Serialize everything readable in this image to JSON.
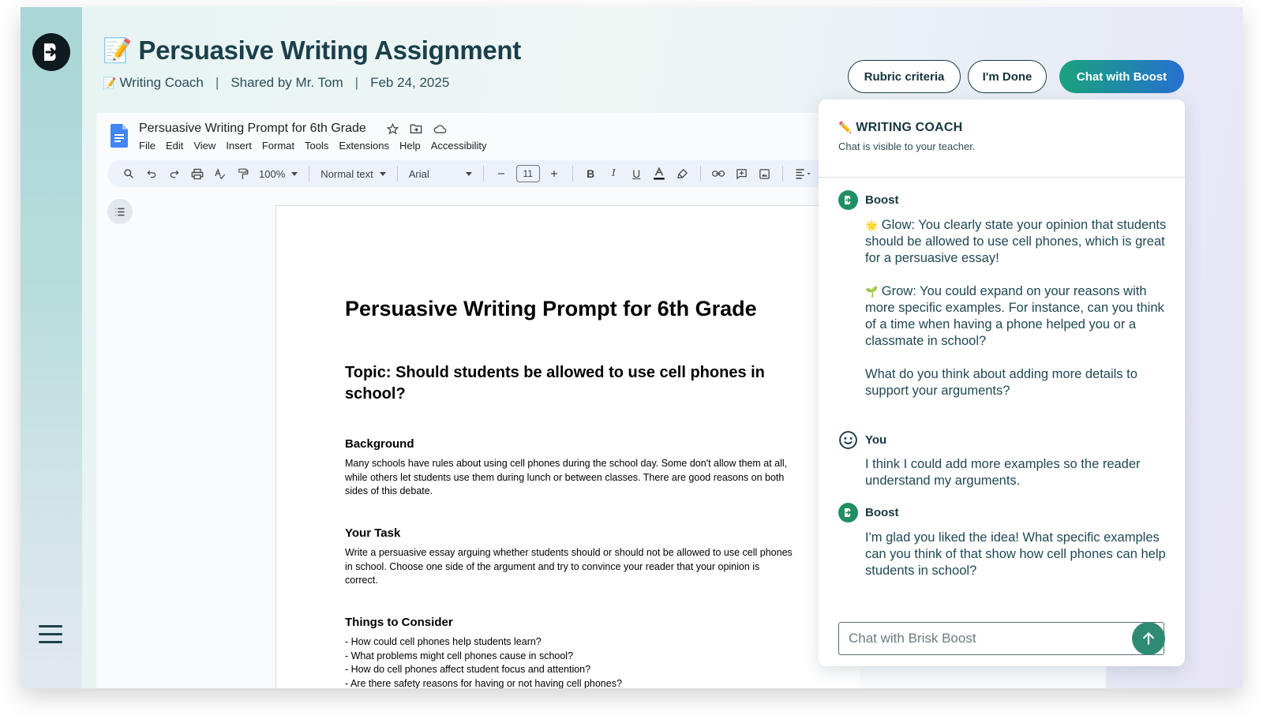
{
  "header": {
    "title_emoji": "📝",
    "title": "Persuasive Writing Assignment",
    "meta_emoji": "📝",
    "tool": "Writing Coach",
    "shared_by": "Shared by Mr. Tom",
    "date": "Feb 24, 2025"
  },
  "actions": {
    "rubric": "Rubric criteria",
    "done": "I'm Done",
    "chat": "Chat with Boost"
  },
  "docs": {
    "doc_name": "Persuasive Writing Prompt for 6th Grade",
    "menu": [
      "File",
      "Edit",
      "View",
      "Insert",
      "Format",
      "Tools",
      "Extensions",
      "Help",
      "Accessibility"
    ],
    "toolbar": {
      "zoom": "100%",
      "style": "Normal text",
      "font": "Arial",
      "font_size": "11"
    }
  },
  "document": {
    "h1": "Persuasive Writing Prompt for 6th Grade",
    "topic": "Topic: Should students be allowed to use cell phones in school?",
    "background_heading": "Background",
    "background_text": "Many schools have rules about using cell phones during the school day. Some don't allow them at all, while others let students use them during lunch or between classes. There are good reasons on both sides of this debate.",
    "task_heading": "Your Task",
    "task_text": "Write a persuasive essay arguing whether students should or should not be allowed to use cell phones in school. Choose one side of the argument and try to convince your reader that your opinion is correct.",
    "consider_heading": "Things to Consider",
    "consider_items": [
      "- How could cell phones help students learn?",
      "- What problems might cell phones cause in school?",
      "- How do cell phones affect student focus and attention?",
      "- Are there safety reasons for having or not having cell phones?"
    ]
  },
  "chat": {
    "title_emoji": "✏️",
    "title": "WRITING COACH",
    "subtitle": "Chat is visible to your teacher.",
    "messages": [
      {
        "speaker": "Boost",
        "glow_emoji": "🌟",
        "glow": "Glow: You clearly state your opinion that students should be allowed to use cell phones, which is great for a persuasive essay!",
        "grow_emoji": "🌱",
        "grow": "Grow: You could expand on your reasons with more specific examples. For instance, can you think of a time when having a phone helped you or a classmate in school?",
        "question": "What do you think about adding more details to support your arguments?"
      },
      {
        "speaker": "You",
        "text": "I think I could add more examples so the reader understand my arguments."
      },
      {
        "speaker": "Boost",
        "text": "I'm glad you liked the idea! What specific examples can you think of that show how cell phones can help students in school?"
      }
    ],
    "input_placeholder": "Chat with Brisk Boost"
  },
  "colors": {
    "accent_green": "#1aa37c",
    "accent_blue": "#2670d0",
    "title_text": "#1a3f4a",
    "boost_avatar": "#1f8f64",
    "send_button": "#2f8a73"
  },
  "icons": {
    "logo": "brisk-logo-icon",
    "menu": "hamburger-menu-icon",
    "send": "arrow-up-icon",
    "you_avatar": "smiley-face-icon"
  }
}
